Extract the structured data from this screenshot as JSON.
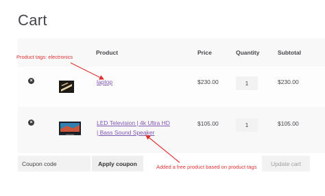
{
  "page": {
    "title": "Cart"
  },
  "table": {
    "headers": {
      "product": "Product",
      "price": "Price",
      "quantity": "Quantity",
      "subtotal": "Subtotal"
    },
    "rows": [
      {
        "remove": "×",
        "name": "laptop",
        "price": "$230.00",
        "quantity": "1",
        "subtotal": "$230.00"
      },
      {
        "remove": "×",
        "name": "LED Television | 4k Ultra HD | Bass Sound Speaker",
        "price": "$105.00",
        "quantity": "1",
        "subtotal": "$105.00"
      }
    ]
  },
  "actions": {
    "coupon_placeholder": "Coupon code",
    "apply_label": "Apply coupon",
    "update_label": "Update cart"
  },
  "annotations": {
    "tags_note": "Product tags: electronics",
    "free_note": "Added a free product based on product tags",
    "color": "#e03030"
  },
  "colors": {
    "link": "#7f54b3",
    "text": "#43454b"
  }
}
